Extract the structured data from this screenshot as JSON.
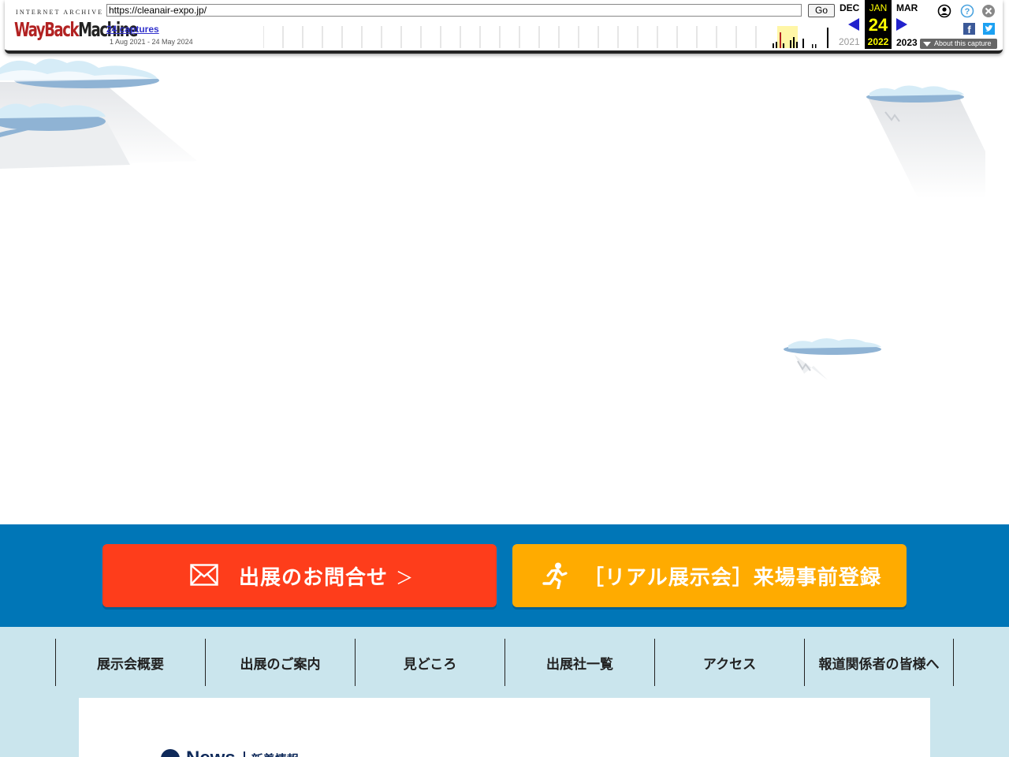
{
  "wayback": {
    "logo_top": "INTERNET ARCHIVE",
    "logo_wayback": "WayBack",
    "logo_machine": "Machine",
    "url": "https://cleanair-expo.jp/",
    "go_label": "Go",
    "captures_label": "24 captures",
    "date_range": "1 Aug 2021 - 24 May 2024",
    "prev_month": "DEC",
    "prev_year": "2021",
    "current_month": "JAN",
    "current_day": "24",
    "current_year": "2022",
    "next_month": "MAR",
    "next_year": "2023",
    "about_label": "About this capture",
    "facebook_glyph": "f",
    "icons": [
      "user-icon",
      "help-icon",
      "close-icon",
      "facebook-icon",
      "twitter-icon"
    ]
  },
  "cta": {
    "contact_label": "出展のお問合せ",
    "register_label": "［リアル展示会］来場事前登録",
    "arrow_glyph": "＞",
    "contact_color": "#fe3d1b",
    "register_color": "#ffab00",
    "band_color": "#0076b7"
  },
  "nav": {
    "items": [
      {
        "label": "展示会概要"
      },
      {
        "label": "出展のご案内"
      },
      {
        "label": "見どころ"
      },
      {
        "label": "出展社一覧"
      },
      {
        "label": "アクセス"
      },
      {
        "label": "報道関係者の皆様へ"
      }
    ],
    "bg_color": "#cae5ed"
  },
  "news": {
    "title": "News",
    "subtitle": "新着情報"
  }
}
